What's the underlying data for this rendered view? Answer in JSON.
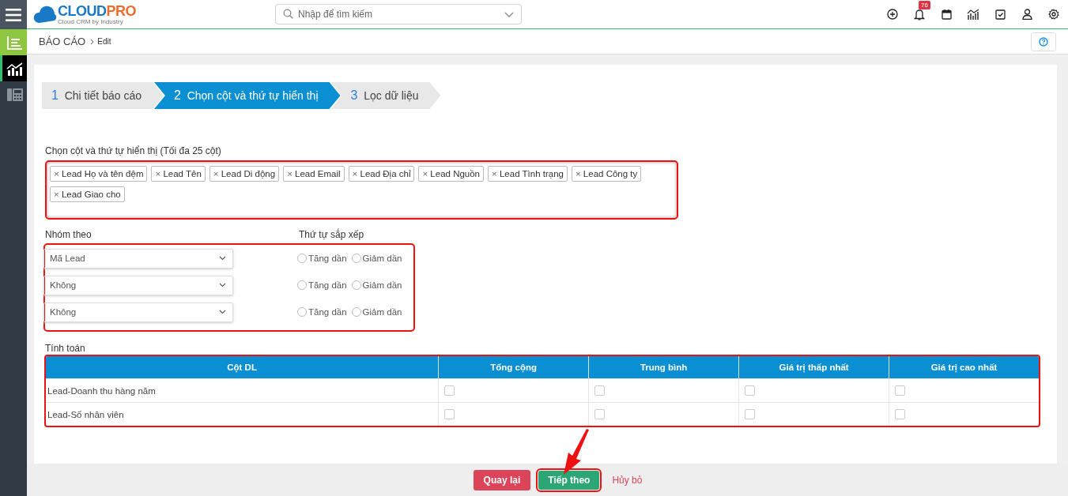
{
  "sidebar": {
    "items": [
      {
        "kind": "list",
        "selected": false,
        "color": "#8dc63f"
      },
      {
        "kind": "chart",
        "selected": true,
        "color": "#000000"
      },
      {
        "kind": "phone",
        "selected": false,
        "color": "#2f3a45"
      }
    ]
  },
  "logo": {
    "brand_a": "CLOUD",
    "brand_b": "PRO",
    "tagline": "Cloud CRM by Industry"
  },
  "search": {
    "placeholder": "Nhập để tìm kiếm"
  },
  "toolbar": {
    "notification_count": "76"
  },
  "breadcrumb": {
    "title": "BÁO CÁO",
    "current": "Edit"
  },
  "steps": [
    {
      "number": "1",
      "label": "Chi tiết báo cáo",
      "selected": false
    },
    {
      "number": "2",
      "label": "Chọn cột và thứ tự hiển thị",
      "selected": true
    },
    {
      "number": "3",
      "label": "Lọc dữ liệu",
      "selected": false
    }
  ],
  "columns_field": {
    "label": "Chọn cột và thứ tự hiển thị (Tối đa 25 cột)",
    "remove_glyph": "×",
    "tags": [
      "Lead Họ và tên đệm",
      "Lead Tên",
      "Lead Di động",
      "Lead Email",
      "Lead Địa chỉ",
      "Lead Nguồn",
      "Lead Tình trạng",
      "Lead Công ty",
      "Lead Giao cho"
    ]
  },
  "grouping": {
    "group_label": "Nhóm theo",
    "order_label": "Thứ tự sắp xếp",
    "rows": [
      {
        "value": "Mã Lead",
        "options": [
          {
            "label": "Tăng dần",
            "selected": false
          },
          {
            "label": "Giảm dần",
            "selected": false
          }
        ]
      },
      {
        "value": "Không",
        "options": [
          {
            "label": "Tăng dần",
            "selected": false
          },
          {
            "label": "Giảm dần",
            "selected": false
          }
        ]
      },
      {
        "value": "Không",
        "options": [
          {
            "label": "Tăng dần",
            "selected": false
          },
          {
            "label": "Giảm dần",
            "selected": false
          }
        ]
      }
    ]
  },
  "calculation": {
    "label": "Tính toán",
    "columns": [
      "Cột DL",
      "Tổng cộng",
      "Trung bình",
      "Giá trị thấp nhất",
      "Giá trị cao nhất"
    ],
    "rows": [
      {
        "name": "Lead-Doanh thu hàng năm",
        "checks": [
          false,
          false,
          false,
          false
        ]
      },
      {
        "name": "Lead-Số nhân viên",
        "checks": [
          false,
          false,
          false,
          false
        ]
      }
    ]
  },
  "footer": {
    "back": "Quay lại",
    "next": "Tiếp theo",
    "cancel": "Hủy bỏ"
  }
}
